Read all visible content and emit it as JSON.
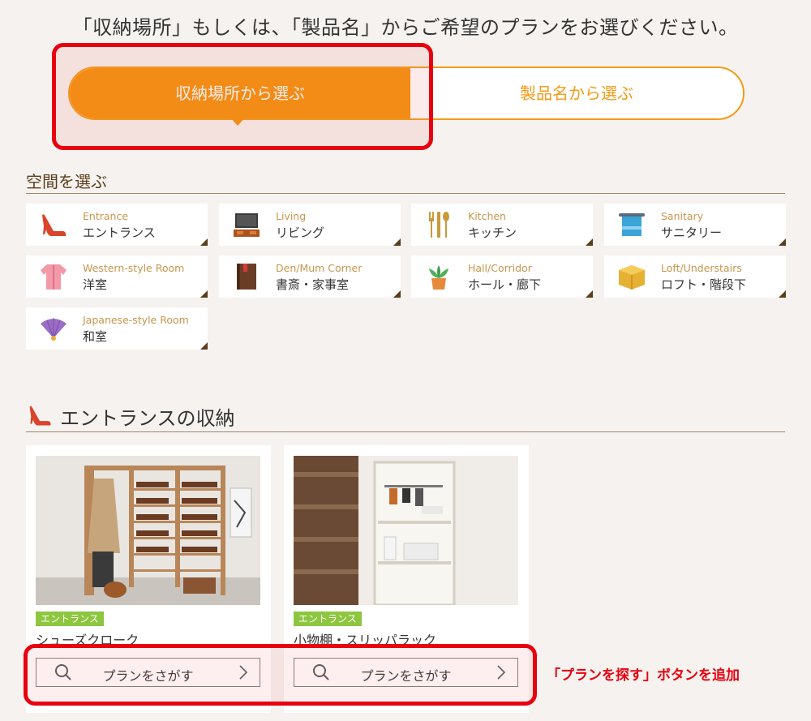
{
  "headline": "「収納場所」もしくは、「製品名」からご希望のプランをお選びください。",
  "toggle": {
    "left_label": "収納場所から選ぶ",
    "right_label": "製品名から選ぶ",
    "active": "left"
  },
  "space_section": {
    "title": "空間を選ぶ",
    "items": [
      {
        "en": "Entrance",
        "ja": "エントランス",
        "icon": "high-heel-icon"
      },
      {
        "en": "Living",
        "ja": "リビング",
        "icon": "tv-icon"
      },
      {
        "en": "Kitchen",
        "ja": "キッチン",
        "icon": "cutlery-icon"
      },
      {
        "en": "Sanitary",
        "ja": "サニタリー",
        "icon": "towel-icon"
      },
      {
        "en": "Western-style Room",
        "ja": "洋室",
        "icon": "shirt-icon"
      },
      {
        "en": "Den/Mum Corner",
        "ja": "書斎・家事室",
        "icon": "book-icon"
      },
      {
        "en": "Hall/Corridor",
        "ja": "ホール・廊下",
        "icon": "plant-icon"
      },
      {
        "en": "Loft/Understairs",
        "ja": "ロフト・階段下",
        "icon": "box-icon"
      },
      {
        "en": "Japanese-style Room",
        "ja": "和室",
        "icon": "folding-fan-icon"
      }
    ]
  },
  "entrance_section": {
    "title": "エントランスの収納",
    "products": [
      {
        "tag": "エントランス",
        "title": "シューズクローク",
        "button": "プランをさがす"
      },
      {
        "tag": "エントランス",
        "title": "小物棚・スリッパラック",
        "button": "プランをさがす"
      }
    ]
  },
  "annotation": "「プランを探す」ボタンを追加",
  "colors": {
    "accent": "#f49005",
    "highlight": "#e8000e",
    "tag": "#8dc63f",
    "background": "#f6f2ef"
  }
}
